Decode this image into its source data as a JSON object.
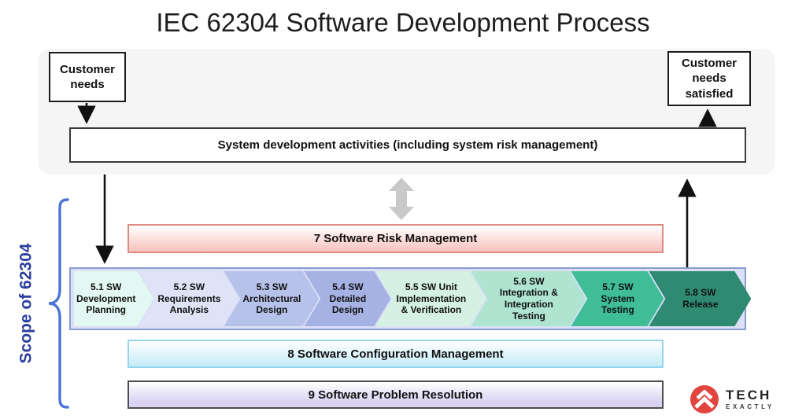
{
  "title": "IEC 62304 Software Development Process",
  "top_panel": {
    "customer_needs_label": "Customer needs",
    "customer_needs_satisfied_label": "Customer needs satisfied",
    "system_activities_label": "System development activities (including system risk management)"
  },
  "scope": {
    "label": "Scope of 62304",
    "text_color": "#2c3f9e",
    "brace_color": "#4a72d8"
  },
  "risk_bar": {
    "label": "7 Software Risk Management",
    "fill": "#f7c5c0",
    "border": "#dd8a84"
  },
  "config_bar": {
    "label": "8 Software Configuration Management",
    "fill": "#c8ecf8",
    "border": "#96d5ec"
  },
  "problem_bar": {
    "label": "9 Software Problem Resolution",
    "fill": "#d9d2f2",
    "border": "#4d4d4d"
  },
  "process_steps": [
    {
      "label": "5.1 SW Development Planning",
      "fill": "#e3f8f2"
    },
    {
      "label": "5.2 SW Requirements Analysis",
      "fill": "#dee3f6"
    },
    {
      "label": "5.3 SW Architectural Design",
      "fill": "#b7c2ea"
    },
    {
      "label": "5.4 SW Detailed Design",
      "fill": "#a7b2e4"
    },
    {
      "label": "5.5 SW Unit Implementation & Verification",
      "fill": "#d5f1e3"
    },
    {
      "label": "5.6 SW Integration & Integration Testing",
      "fill": "#aee4d0"
    },
    {
      "label": "5.7 SW System Testing",
      "fill": "#3ebd97"
    },
    {
      "label": "5.8 SW Release",
      "fill": "#2f8a72"
    }
  ],
  "logo": {
    "name": "TECH",
    "sub": "EXACTLY",
    "mark_color": "#e2453e"
  }
}
